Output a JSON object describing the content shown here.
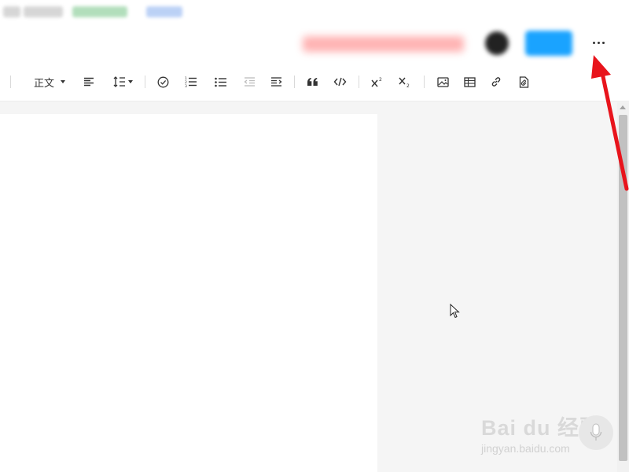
{
  "header": {
    "more_button_label": "···"
  },
  "toolbar": {
    "paragraph_style": "正文",
    "items": [
      {
        "name": "align-left"
      },
      {
        "name": "line-height"
      },
      {
        "name": "todo-list"
      },
      {
        "name": "ordered-list"
      },
      {
        "name": "bullet-list"
      },
      {
        "name": "outdent"
      },
      {
        "name": "indent"
      },
      {
        "name": "quote"
      },
      {
        "name": "code"
      },
      {
        "name": "superscript"
      },
      {
        "name": "subscript"
      },
      {
        "name": "insert-image"
      },
      {
        "name": "insert-table"
      },
      {
        "name": "insert-link"
      },
      {
        "name": "insert-attachment"
      }
    ]
  },
  "watermark": {
    "brand": "Bai du 经验",
    "url": "jingyan.baidu.com"
  },
  "colors": {
    "annotation_arrow": "#e8141c",
    "scroll_thumb": "#c1c1c1",
    "page_bg": "#f5f5f5"
  }
}
